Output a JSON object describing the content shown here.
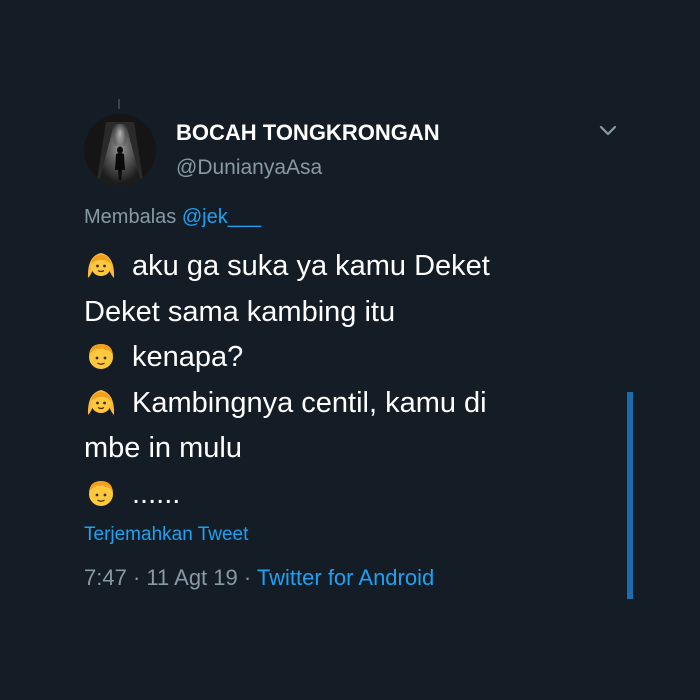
{
  "tweet": {
    "display_name": "BOCAH TONGKRONGAN",
    "handle": "@DunianyaAsa",
    "reply_prefix": "Membalas",
    "reply_to": "@jek___",
    "lines": [
      {
        "emoji": "girl-emoji",
        "text": "aku ga suka ya kamu Deket"
      },
      {
        "emoji": "",
        "text": "Deket sama kambing itu"
      },
      {
        "emoji": "boy-emoji",
        "text": "kenapa?"
      },
      {
        "emoji": "girl-emoji",
        "text": "Kambingnya centil, kamu di"
      },
      {
        "emoji": "",
        "text": "mbe in mulu"
      },
      {
        "emoji": "boy-emoji",
        "text": "......"
      }
    ],
    "translate_label": "Terjemahkan Tweet",
    "time": "7:47",
    "separator": "·",
    "date": "11 Agt 19",
    "source": "Twitter for Android"
  },
  "icons": {
    "menu": "chevron-down-icon",
    "avatar": "avatar-image"
  },
  "colors": {
    "background": "#141d26",
    "text": "#ffffff",
    "secondary": "#8899a6",
    "link": "#1da1f2",
    "scrollbar": "#1b6dad"
  }
}
